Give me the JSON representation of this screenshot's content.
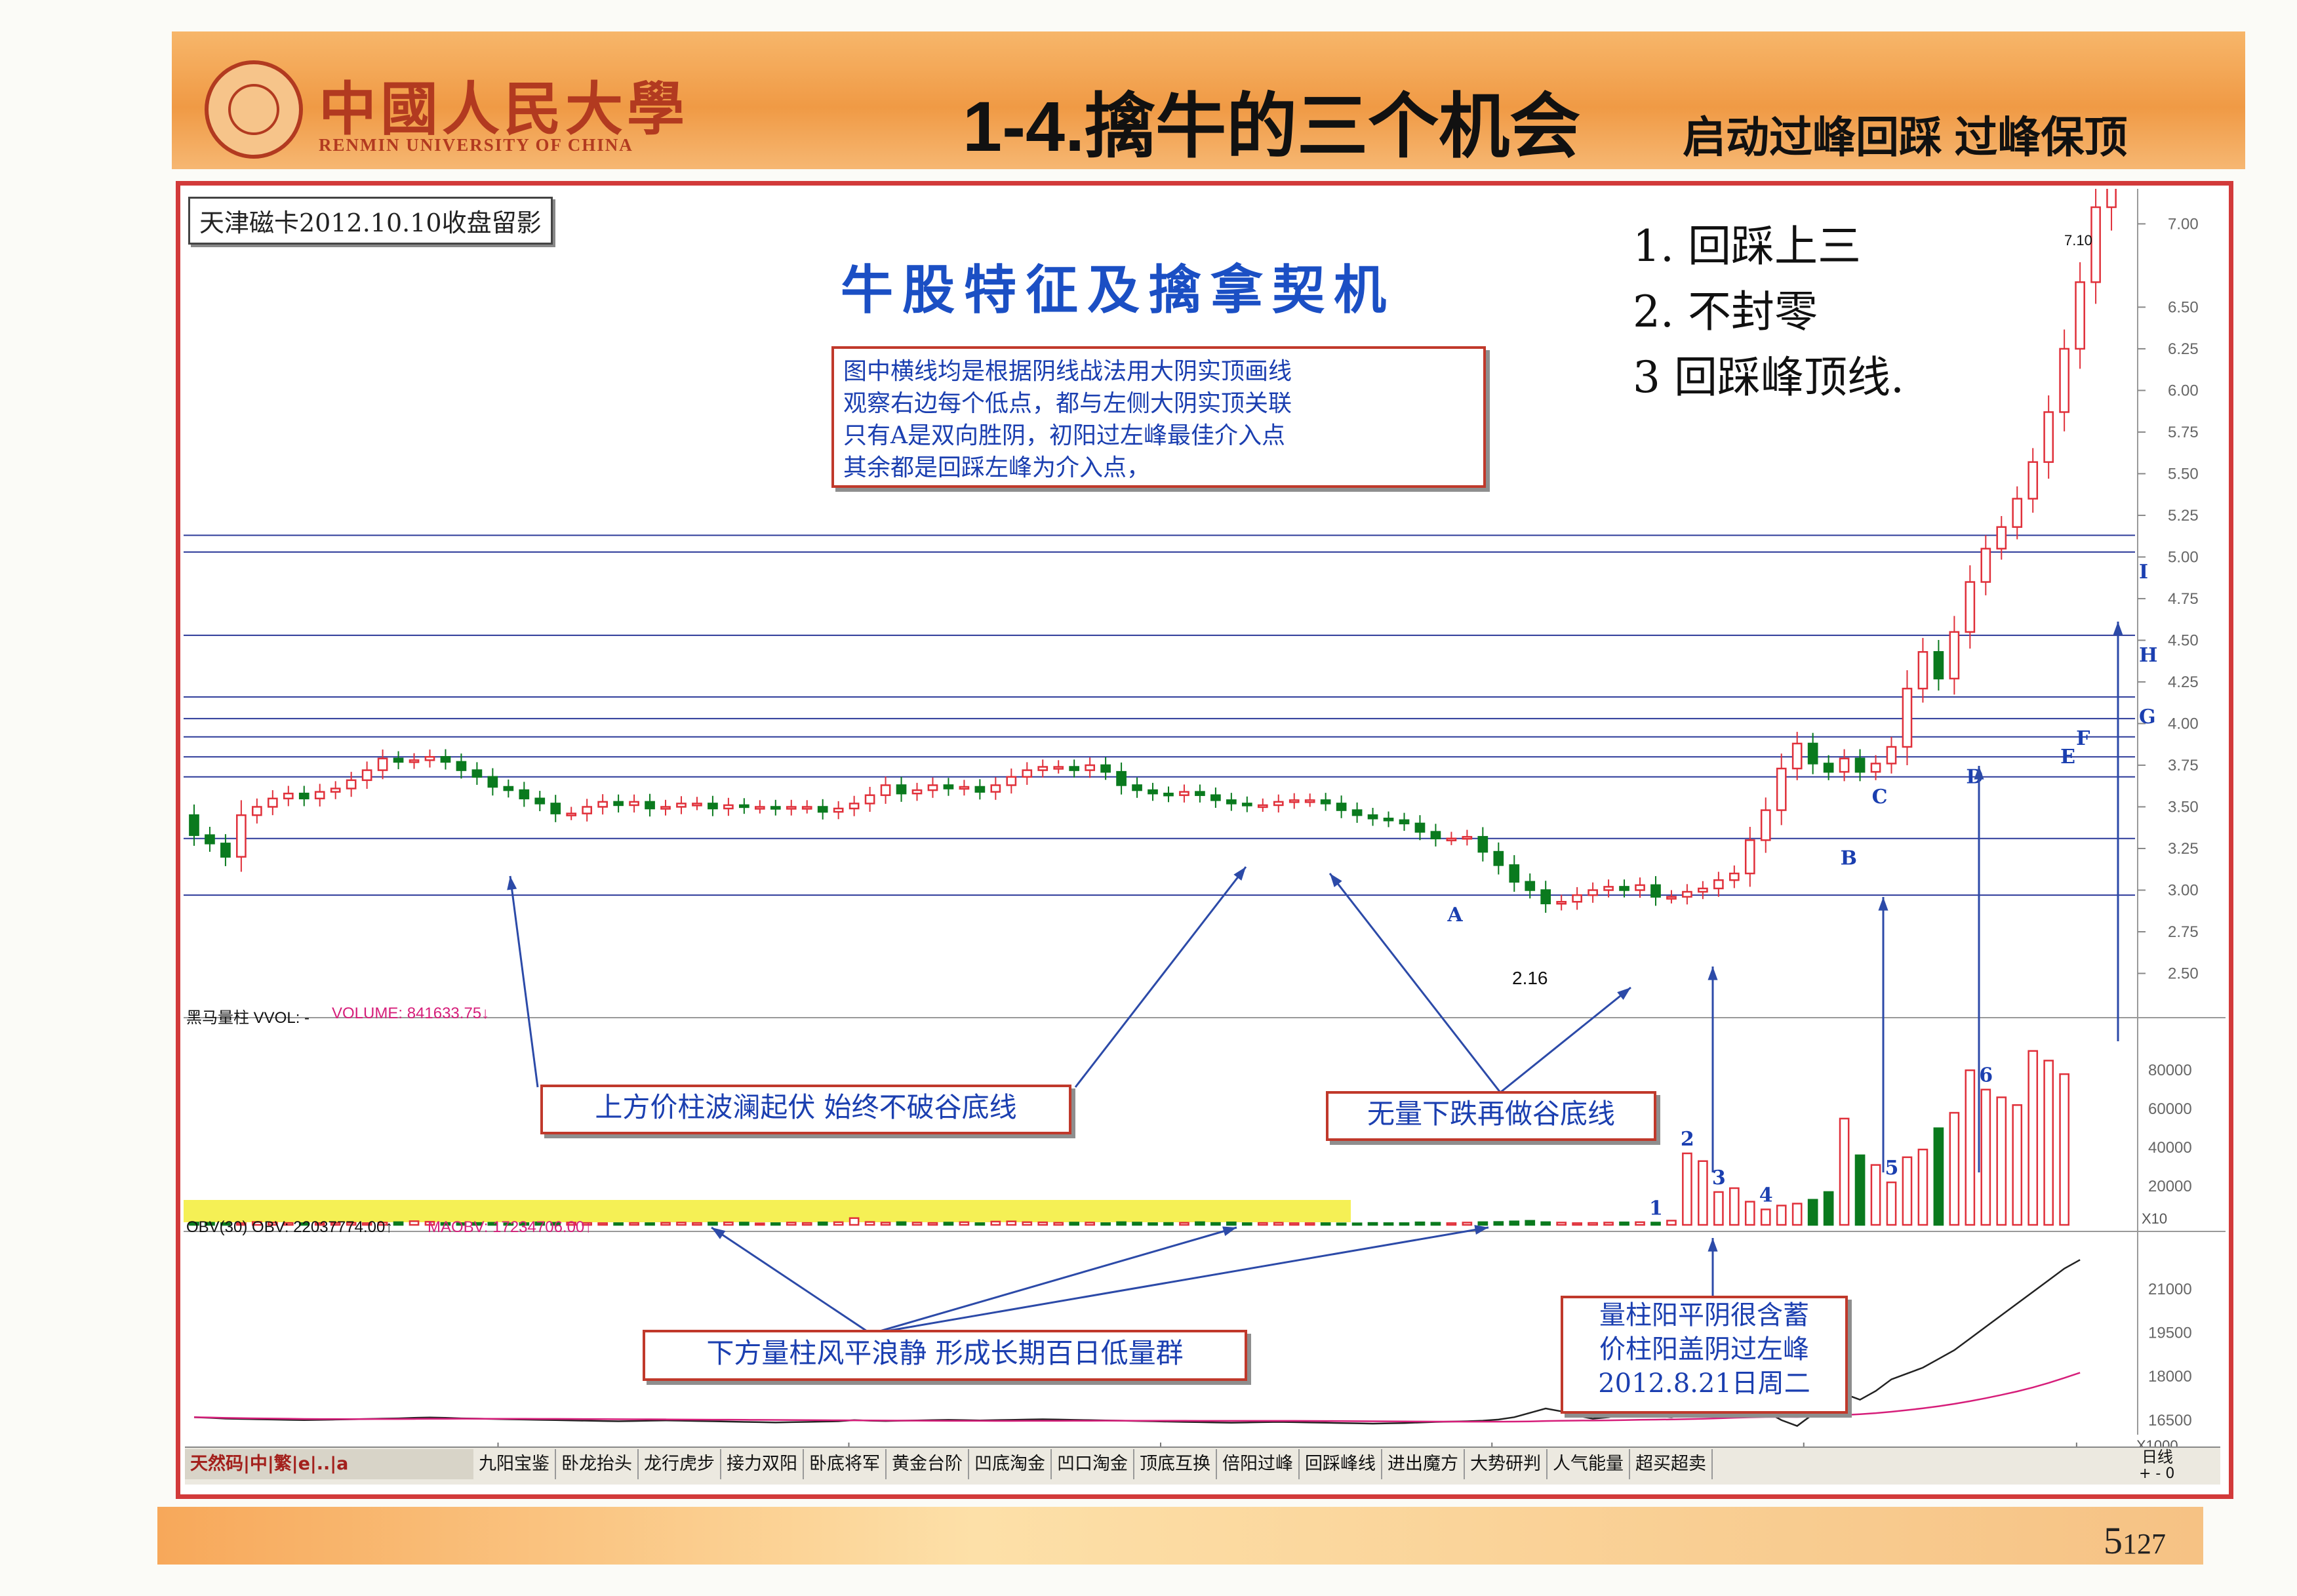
{
  "header": {
    "university_cn": "中國人民大學",
    "university_en": "RENMIN UNIVERSITY OF CHINA",
    "title_main": "1-4.擒牛的三个机会",
    "title_sub": "启动过峰回踩 过峰保顶"
  },
  "stock_tag": "天津磁卡2012.10.10收盘留影",
  "chart_title": "牛股特征及擒拿契机",
  "note_lines": [
    "图中横线均是根据阴线战法用大阴实顶画线",
    "观察右边每个低点，都与左侧大阴实顶关联",
    "只有A是双向胜阴，初阳过左峰最佳介入点",
    "其余都是回踩左峰为介入点，"
  ],
  "handwritten": [
    "1. 回踩上三",
    "2. 不封零",
    "3 回踩峰顶线."
  ],
  "callouts": {
    "price": "上方价柱波澜起伏 始终不破谷底线",
    "fall": "无量下跌再做谷底线",
    "volume": "下方量柱风平浪静 形成长期百日低量群",
    "date_line1": "量柱阳平阴很含蓄",
    "date_line2": "价柱阳盖阴过左峰",
    "date_line3": "2012.8.21日周二"
  },
  "indicators": {
    "vol_label": "黑马量柱 VVOL: -",
    "vol_value": "VOLUME: 841633.75↓",
    "obv_label": "OBV(30) OBV: 22037774.00↑",
    "maobv": "MAOBV: 17234706.00↑",
    "x1000": "X1000",
    "x10": "X10",
    "low_label": "2.16",
    "high_label": "7.10",
    "days_label": "日线",
    "zoom_controls": "+ - 0"
  },
  "tabs": {
    "left_tools": "天然码|中|繁|e|..|a",
    "items": [
      "九阳宝鉴",
      "卧龙抬头",
      "龙行虎步",
      "接力双阳",
      "卧底将军",
      "黄金台阶",
      "凹底淘金",
      "凹口淘金",
      "顶底互换",
      "倍阳过峰",
      "回踩峰线",
      "进出魔方",
      "大势研判",
      "人气能量",
      "超买超卖"
    ]
  },
  "page": {
    "number": "5",
    "sub": "127"
  },
  "colors": {
    "up": "#e0303a",
    "down": "#0a7a1e",
    "line": "#2c3a99",
    "accent": "#1b3fb0",
    "frame": "#d23a3a"
  },
  "chart_data": {
    "type": "candlestick",
    "title": "天津磁卡2012.10.10收盘留影",
    "ylim": [
      2.25,
      7.1
    ],
    "y_ticks": [
      2.5,
      2.75,
      3.0,
      3.25,
      3.5,
      3.75,
      4.0,
      4.25,
      4.5,
      4.75,
      5.0,
      5.25,
      5.5,
      5.75,
      6.0,
      6.25,
      6.5,
      7.0
    ],
    "month_ticks": [
      "5",
      "6",
      "7",
      "8",
      "9",
      "10"
    ],
    "horizontal_lines": [
      2.97,
      3.31,
      3.68,
      3.8,
      3.92,
      4.03,
      4.16,
      4.53,
      5.03,
      5.13
    ],
    "point_labels": [
      "A",
      "B",
      "C",
      "D",
      "E",
      "F",
      "G",
      "H",
      "I"
    ],
    "volume_labels": [
      "1",
      "2",
      "3",
      "4",
      "5",
      "6"
    ],
    "volume_axis": [
      20000,
      40000,
      60000,
      80000
    ],
    "obv_axis": [
      16500,
      18000,
      19500,
      21000
    ],
    "price_start": 3.45,
    "price_ohlc_changes": [
      -0.12,
      -0.05,
      -0.08,
      0.25,
      0.05,
      0.05,
      0.03,
      -0.03,
      0.04,
      0.02,
      0.05,
      0.06,
      0.07,
      -0.02,
      0.01,
      0.02,
      -0.03,
      -0.05,
      -0.04,
      -0.06,
      -0.02,
      -0.05,
      -0.03,
      -0.06,
      0.0,
      0.04,
      0.03,
      -0.02,
      0.02,
      -0.04,
      0.01,
      0.02,
      0.0,
      -0.03,
      0.02,
      -0.01,
      0.0,
      -0.01,
      0.01,
      0.0,
      -0.03,
      0.02,
      0.03,
      0.05,
      0.06,
      -0.05,
      0.02,
      0.03,
      -0.02,
      0.01,
      -0.03,
      0.04,
      0.05,
      0.04,
      0.02,
      0.0,
      -0.02,
      0.03,
      -0.04,
      -0.08,
      -0.03,
      -0.02,
      -0.01,
      0.02,
      -0.02,
      -0.03,
      -0.02,
      -0.01,
      0.0,
      0.02,
      0.01,
      0.0,
      -0.02,
      -0.04,
      -0.03,
      -0.02,
      -0.01,
      -0.02,
      -0.05,
      -0.04,
      0.0,
      0.01,
      -0.09,
      -0.08,
      -0.1,
      -0.05,
      -0.08,
      0.01,
      0.04,
      0.03,
      0.02,
      -0.02,
      0.03,
      -0.07,
      0.0,
      0.03,
      0.02,
      0.05,
      0.04,
      0.2,
      0.18,
      0.25,
      0.15,
      -0.12,
      -0.05,
      0.08,
      -0.08,
      0.05,
      0.1,
      0.35,
      0.22,
      -0.16,
      0.28,
      0.3,
      0.2,
      0.13,
      0.17,
      0.22,
      0.3,
      0.38,
      0.4,
      0.45,
      0.5,
      0.55
    ],
    "volume_values": [
      1200,
      1100,
      900,
      900,
      1500,
      1200,
      1000,
      900,
      900,
      1000,
      1100,
      900,
      1200,
      1400,
      1900,
      1600,
      1000,
      900,
      1000,
      1100,
      800,
      900,
      1300,
      1100,
      1200,
      1000,
      900,
      900,
      1000,
      900,
      1100,
      1200,
      1000,
      1200,
      1300,
      1200,
      800,
      900,
      1200,
      1000,
      1300,
      1400,
      3500,
      1500,
      1200,
      1400,
      1200,
      1000,
      1200,
      1400,
      900,
      1700,
      1800,
      1400,
      1300,
      1100,
      1200,
      1200,
      900,
      1400,
      1200,
      900,
      1000,
      1100,
      1400,
      1000,
      1300,
      900,
      1000,
      1100,
      900,
      900,
      900,
      800,
      800,
      1000,
      900,
      900,
      1300,
      1100,
      900,
      1200,
      1400,
      1500,
      1800,
      2100,
      1400,
      1200,
      900,
      1000,
      1200,
      1300,
      1400,
      1200,
      2200,
      37000,
      33000,
      17000,
      19000,
      12000,
      8000,
      10000,
      11000,
      13000,
      17000,
      55000,
      36000,
      31000,
      22000,
      35000,
      39000,
      50000,
      58000,
      80000,
      70000,
      66000,
      62000,
      90000,
      85000,
      78000
    ],
    "obv_values": [
      16600,
      16580,
      16550,
      16540,
      16530,
      16520,
      16510,
      16500,
      16510,
      16520,
      16530,
      16540,
      16550,
      16560,
      16580,
      16590,
      16580,
      16560,
      16550,
      16540,
      16530,
      16520,
      16510,
      16500,
      16490,
      16480,
      16470,
      16460,
      16470,
      16480,
      16490,
      16480,
      16470,
      16460,
      16450,
      16440,
      16430,
      16420,
      16430,
      16440,
      16450,
      16460,
      16500,
      16480,
      16470,
      16480,
      16490,
      16500,
      16510,
      16500,
      16490,
      16500,
      16510,
      16520,
      16530,
      16520,
      16510,
      16500,
      16490,
      16480,
      16470,
      16460,
      16450,
      16440,
      16430,
      16420,
      16410,
      16420,
      16430,
      16440,
      16430,
      16420,
      16410,
      16400,
      16390,
      16380,
      16390,
      16400,
      16420,
      16440,
      16450,
      16460,
      16480,
      16520,
      16600,
      16750,
      16900,
      16800,
      16650,
      16550,
      16600,
      16700,
      16800,
      16650,
      16600,
      16700,
      16800,
      16900,
      17000,
      16900,
      16800,
      16500,
      16300,
      16700,
      17100,
      17400,
      17200,
      17500,
      17900,
      18100,
      18300,
      18600,
      18900,
      19300,
      19700,
      20100,
      20500,
      20900,
      21300,
      21700,
      22000
    ]
  }
}
